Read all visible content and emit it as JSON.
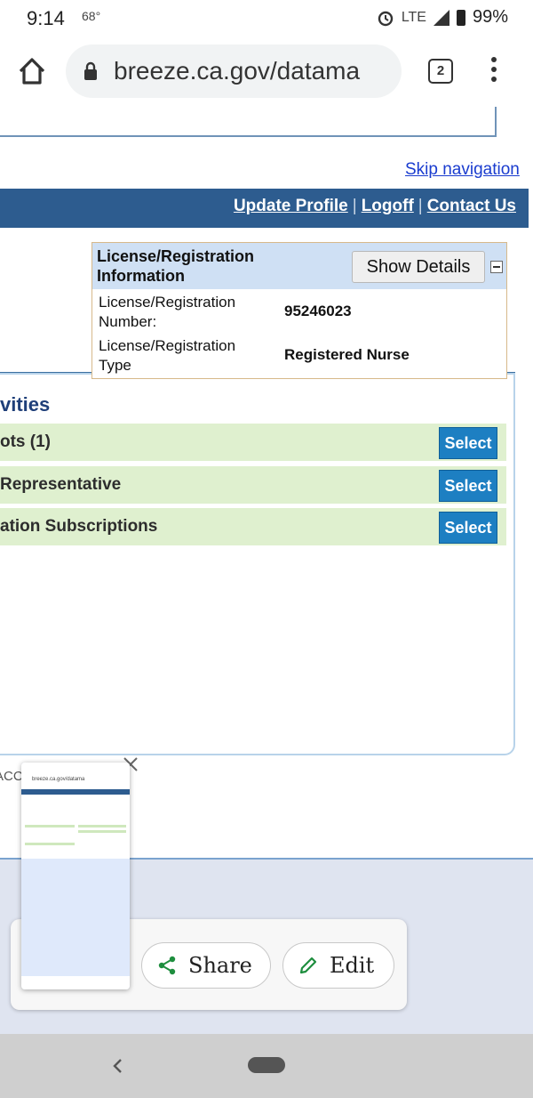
{
  "status_bar": {
    "time": "9:14",
    "temperature": "68°",
    "network": "LTE",
    "battery": "99%"
  },
  "browser": {
    "url": "breeze.ca.gov/datama",
    "tab_count": "2"
  },
  "page": {
    "skip_navigation": "Skip navigation",
    "nav": {
      "update_profile": "Update Profile",
      "logoff": "Logoff",
      "contact_us": "Contact Us",
      "separator": "|"
    },
    "license_panel": {
      "title": "License/Registration Information",
      "show_details": "Show Details",
      "rows": [
        {
          "label": "License/Registration Number:",
          "value": "95246023"
        },
        {
          "label": "License/Registration Type",
          "value": "Registered Nurse"
        }
      ]
    },
    "activities_title": "vities",
    "activities": [
      {
        "label": "ots (1)",
        "button": "Select"
      },
      {
        "label": " Representative",
        "button": "Select"
      },
      {
        "label": "ation Subscriptions",
        "button": "Select"
      }
    ],
    "footer_fragment": "ACC"
  },
  "screenshot_toast": {
    "share": "Share",
    "edit": "Edit",
    "thumbnail_url": "breeze.ca.gov/datama"
  },
  "colors": {
    "nav_blue": "#2d5c8f",
    "select_blue": "#1d7fc2",
    "row_green": "#dff0cf",
    "link_blue": "#1a3ccf"
  }
}
